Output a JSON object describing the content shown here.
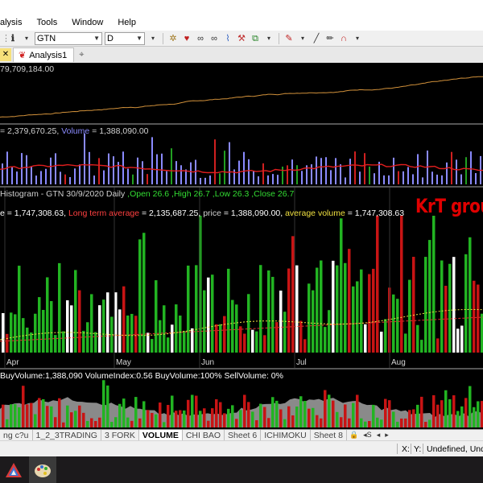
{
  "menu": [
    "alysis",
    "Tools",
    "Window",
    "Help"
  ],
  "toolbar": {
    "symbol": "GTN",
    "interval": "D",
    "tool_icons": [
      "info-icon",
      "dropdown-icon",
      "gear-icon",
      "heart-icon",
      "glasses-icon",
      "glasses-icon",
      "chart-icon",
      "wand-icon",
      "export-icon",
      "pen-icon",
      "line-icon",
      "pencil-icon",
      "magnet-icon"
    ]
  },
  "tabs": {
    "close": "✕",
    "analysis": "Analysis1",
    "pin": "⌖"
  },
  "panes": {
    "price_label": "79,709,184.00",
    "volume_label": {
      "part1": "= 2,379,670.25, ",
      "vol_name": "Volume",
      "vol_value": " = 1,388,090.00"
    },
    "histogram_title": {
      "name": "Histogram - GTN",
      "date": " 30/9/2020 ",
      "interval": " Daily",
      "ohlc": " ,Open 26.6 ,High 26.7 ,Low 26.3 ,Close 26.7"
    },
    "histogram_values": {
      "p1": "e = 1,747,308.63, ",
      "long_term": "Long term average",
      "p2": " = 2,135,687.25, ",
      "price": "price",
      "p3": " = 1,388,090.00, ",
      "avg_vol": "average volume",
      "p4": " = 1,747,308.63"
    },
    "watermark": "KrT group",
    "buy_label": " BuyVolume:1,388,090 VolumeIndex:0.56 BuyVolume:100% SellVolume: 0%"
  },
  "months": [
    "Apr",
    "May",
    "Jun",
    "Jul",
    "Aug"
  ],
  "sheets": [
    "ng c?u",
    "1_2_3TRADING",
    "3 FORK",
    "VOLUME",
    "CHI BAO",
    "Sheet 6",
    "ICHIMOKU",
    "Sheet 8"
  ],
  "active_sheet": "VOLUME",
  "sheet_ctrls": [
    "🔒",
    "◂S",
    "◂",
    "▸"
  ],
  "status": {
    "x": "X:",
    "y": "Y:",
    "undefined": "Undefined, Unde"
  },
  "colors": {
    "up": "#22b422",
    "down": "#c81414",
    "neutral": "#ffffff",
    "price_line": "#d0903a",
    "volume_bar": "#8a8aff",
    "avg_line": "#e01e1e"
  },
  "chart_data": {
    "type": "bar",
    "title": "Histogram - GTN",
    "series": [
      {
        "name": "Volume",
        "values": [
          1388090
        ]
      },
      {
        "name": "Long term average",
        "values": [
          2135687.25
        ]
      },
      {
        "name": "average volume",
        "values": [
          1747308.63
        ]
      }
    ],
    "ohlc": {
      "open": 26.6,
      "high": 26.7,
      "low": 26.3,
      "close": 26.7,
      "date": "30/9/2020"
    },
    "x_ticks": [
      "Apr",
      "May",
      "Jun",
      "Jul",
      "Aug"
    ]
  }
}
